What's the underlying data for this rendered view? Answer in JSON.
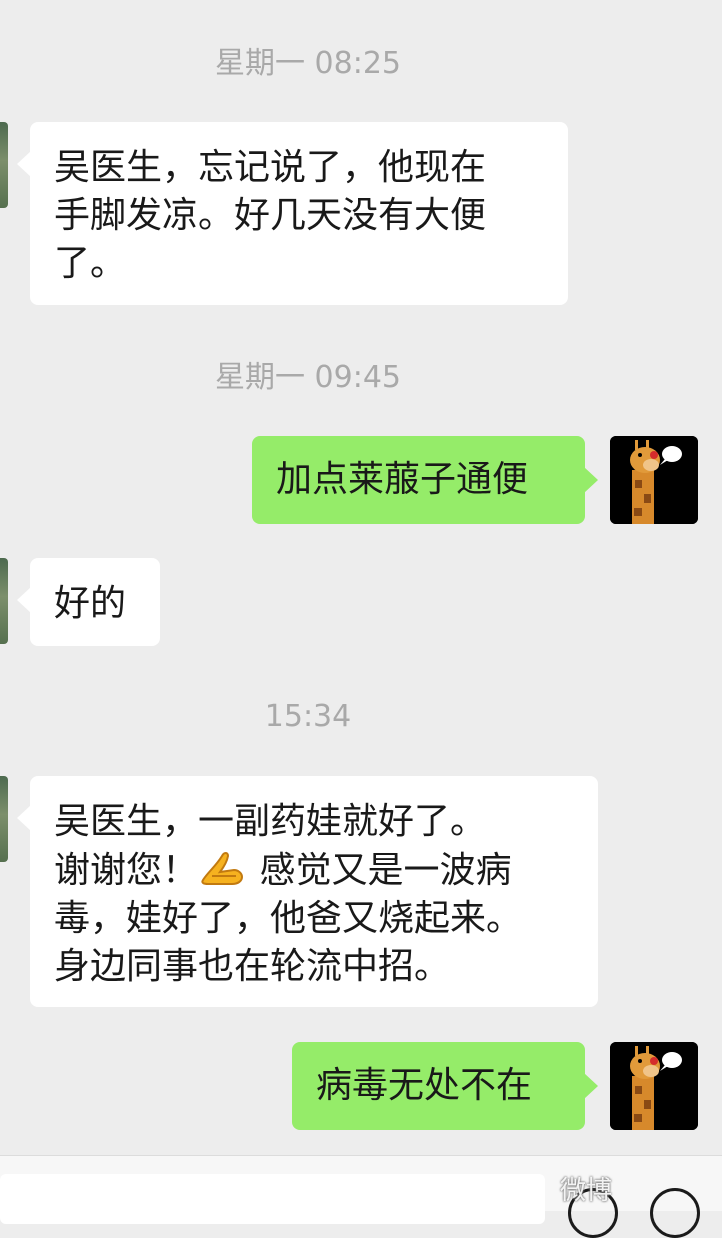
{
  "messages": [
    {
      "kind": "time",
      "text": "星期一 08:25"
    },
    {
      "kind": "incoming",
      "lines": [
        "吴医生，忘记说了，他现在",
        "手脚发凉。好几天没有大便",
        "了。"
      ]
    },
    {
      "kind": "time",
      "text": "星期一 09:45"
    },
    {
      "kind": "outgoing",
      "text": "加点莱菔子通便"
    },
    {
      "kind": "incoming",
      "text": "好的"
    },
    {
      "kind": "time",
      "text": "15:34"
    },
    {
      "kind": "incoming",
      "line1": "吴医生，一副药娃就好了。",
      "line2a": "谢谢您！",
      "line2_emoji": "folded-hands-emoji",
      "line2b": "感觉又是一波病",
      "line3": "毒，娃好了，他爸又烧起来。",
      "line4": "身边同事也在轮流中招。"
    },
    {
      "kind": "outgoing",
      "text": "病毒无处不在"
    }
  ],
  "bottom_bar": {
    "watermark": "微博"
  },
  "colors": {
    "background": "#ededed",
    "incoming_bubble": "#ffffff",
    "outgoing_bubble": "#95ec69",
    "timestamp": "#a9a9a9"
  }
}
